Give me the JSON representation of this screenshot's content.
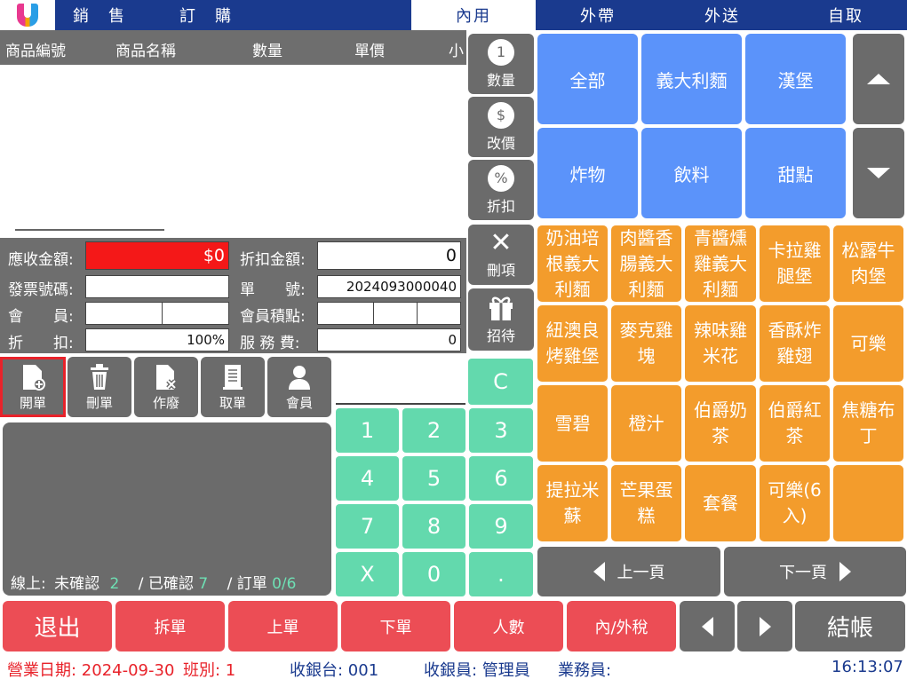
{
  "header": {
    "nav": [
      "銷售",
      "訂購"
    ],
    "tabs": [
      "內用",
      "外帶",
      "外送",
      "自取"
    ],
    "active_tab": "內用",
    "brand_colors": {
      "nav_bg": "#1a3a8e",
      "logo": [
        "#e8398f",
        "#f4a300",
        "#2a9ee6"
      ]
    }
  },
  "order_table": {
    "columns": [
      "商品編號",
      "商品名稱",
      "數量",
      "單價",
      "小"
    ],
    "rows": []
  },
  "summary": {
    "receivable_label": "應收金額:",
    "receivable_value": "$0",
    "discount_amount_label": "折扣金額:",
    "discount_amount_value": "0",
    "invoice_label": "發票號碼:",
    "invoice_value": "",
    "order_no_label": "單　　號:",
    "order_no_value": "2024093000040",
    "member_label": "會　　員:",
    "member_points_label": "會員積點:",
    "discount_label": "折　　扣:",
    "discount_value": "100%",
    "service_fee_label": "服 務 費:",
    "service_fee_value": "0"
  },
  "actions": [
    {
      "label": "開單",
      "icon": "new-order-icon"
    },
    {
      "label": "刪單",
      "icon": "trash-icon"
    },
    {
      "label": "作廢",
      "icon": "void-doc-icon"
    },
    {
      "label": "取單",
      "icon": "receipt-icon"
    },
    {
      "label": "會員",
      "icon": "person-icon"
    }
  ],
  "online_status": {
    "prefix": "線上:",
    "unconfirmed_label": "未確認",
    "unconfirmed_count": "2",
    "confirmed_label": "/ 已確認",
    "confirmed_count": "7",
    "orders_label": "/ 訂單",
    "orders_count": "0/6"
  },
  "tools": [
    {
      "label": "數量",
      "glyph": "1",
      "icon": "quantity-icon"
    },
    {
      "label": "改價",
      "glyph": "$",
      "icon": "dollar-icon"
    },
    {
      "label": "折扣",
      "glyph": "%",
      "icon": "discount-icon"
    },
    {
      "label": "刪項",
      "glyph": "✕",
      "icon": "close-icon"
    },
    {
      "label": "招待",
      "glyph": "🎁",
      "icon": "gift-icon"
    }
  ],
  "keypad": {
    "display": "",
    "keys": [
      "C",
      "1",
      "2",
      "3",
      "4",
      "5",
      "6",
      "7",
      "8",
      "9",
      "X",
      "0",
      "."
    ]
  },
  "categories": [
    "全部",
    "義大利麵",
    "漢堡",
    "炸物",
    "飲料",
    "甜點"
  ],
  "products": [
    "奶油培根義大利麵",
    "肉醬香腸義大利麵",
    "青醬燻雞義大利麵",
    "卡拉雞腿堡",
    "松露牛肉堡",
    "紐澳良烤雞堡",
    "麥克雞塊",
    "辣味雞米花",
    "香酥炸雞翅",
    "可樂",
    "雪碧",
    "橙汁",
    "伯爵奶茶",
    "伯爵紅茶",
    "焦糖布丁",
    "提拉米蘇",
    "芒果蛋糕",
    "套餐",
    "可樂(6入)",
    ""
  ],
  "paging": {
    "prev": "上一頁",
    "next": "下一頁"
  },
  "bottom_bar": {
    "exit": "退出",
    "split": "拆單",
    "up_order": "上單",
    "down_order": "下單",
    "guests": "人數",
    "tax": "內/外稅",
    "checkout": "結帳"
  },
  "status_bar": {
    "business_date": "營業日期: 2024-09-30",
    "shift": "班別: 1",
    "register": "收銀台: 001",
    "cashier": "收銀員: 管理員",
    "staff": "業務員:",
    "time": "16:13:07"
  }
}
